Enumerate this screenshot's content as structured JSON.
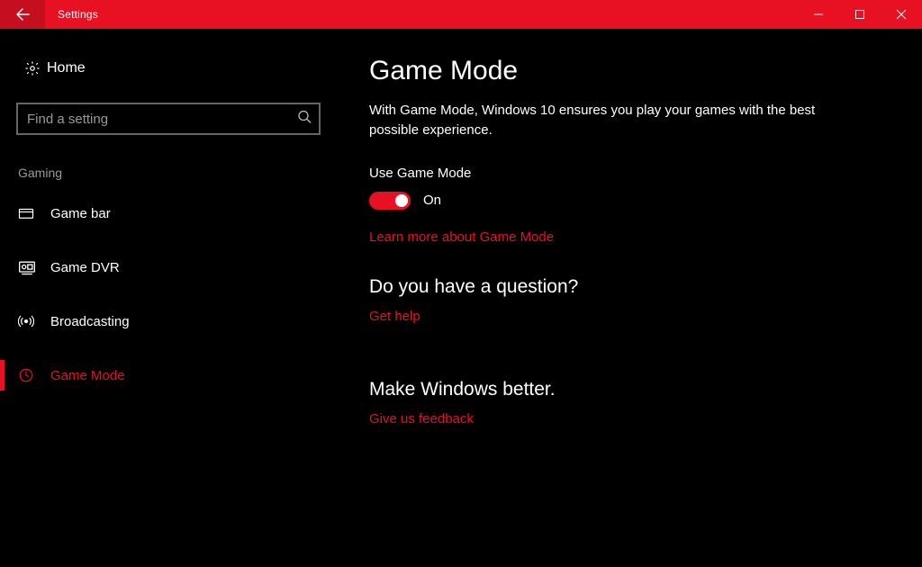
{
  "window": {
    "title": "Settings"
  },
  "sidebar": {
    "home": "Home",
    "search_placeholder": "Find a setting",
    "category": "Gaming",
    "items": [
      {
        "label": "Game bar"
      },
      {
        "label": "Game DVR"
      },
      {
        "label": "Broadcasting"
      },
      {
        "label": "Game Mode"
      }
    ]
  },
  "main": {
    "title": "Game Mode",
    "description": "With Game Mode, Windows 10 ensures you play your games with the best possible experience.",
    "toggle_label": "Use Game Mode",
    "toggle_state": "On",
    "learn_more": "Learn more about Game Mode",
    "question_heading": "Do you have a question?",
    "get_help": "Get help",
    "improve_heading": "Make Windows better.",
    "feedback": "Give us feedback"
  }
}
